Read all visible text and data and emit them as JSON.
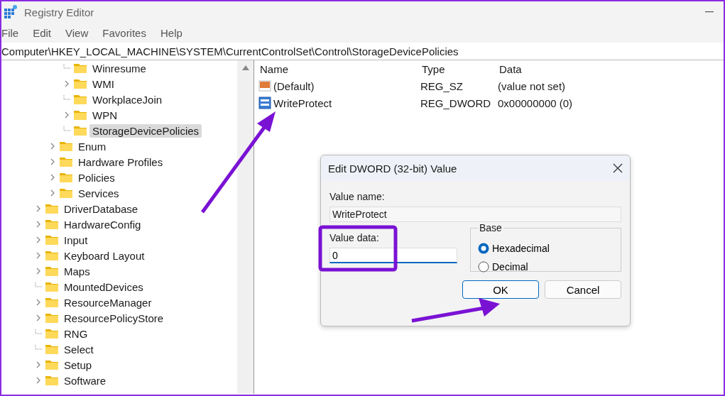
{
  "window": {
    "title": "Registry Editor"
  },
  "menu": [
    "File",
    "Edit",
    "View",
    "Favorites",
    "Help"
  ],
  "address": "Computer\\HKEY_LOCAL_MACHINE\\SYSTEM\\CurrentControlSet\\Control\\StorageDevicePolicies",
  "tree": [
    {
      "children": [
        {
          "children": [
            {
              "label": "Winresume",
              "expandable": false,
              "selected": false
            },
            {
              "label": "WMI",
              "expandable": true,
              "selected": false
            },
            {
              "label": "WorkplaceJoin",
              "expandable": false,
              "selected": false
            },
            {
              "label": "WPN",
              "expandable": true,
              "selected": false
            },
            {
              "label": "StorageDevicePolicies",
              "expandable": false,
              "selected": true
            }
          ]
        },
        {
          "label": "Enum",
          "expandable": true,
          "selected": false
        },
        {
          "label": "Hardware Profiles",
          "expandable": true,
          "selected": false
        },
        {
          "label": "Policies",
          "expandable": true,
          "selected": false
        },
        {
          "label": "Services",
          "expandable": true,
          "selected": false
        }
      ]
    },
    {
      "label": "DriverDatabase",
      "expandable": true,
      "selected": false
    },
    {
      "label": "HardwareConfig",
      "expandable": true,
      "selected": false
    },
    {
      "label": "Input",
      "expandable": true,
      "selected": false
    },
    {
      "label": "Keyboard Layout",
      "expandable": true,
      "selected": false
    },
    {
      "label": "Maps",
      "expandable": true,
      "selected": false
    },
    {
      "label": "MountedDevices",
      "expandable": false,
      "selected": false
    },
    {
      "label": "ResourceManager",
      "expandable": true,
      "selected": false
    },
    {
      "label": "ResourcePolicyStore",
      "expandable": true,
      "selected": false
    },
    {
      "label": "RNG",
      "expandable": false,
      "selected": false
    },
    {
      "label": "Select",
      "expandable": false,
      "selected": false
    },
    {
      "label": "Setup",
      "expandable": true,
      "selected": false
    },
    {
      "label": "Software",
      "expandable": true,
      "selected": false
    }
  ],
  "values": {
    "columns": [
      "Name",
      "Type",
      "Data"
    ],
    "rows": [
      {
        "kind": "string",
        "name": "(Default)",
        "type": "REG_SZ",
        "data": "(value not set)"
      },
      {
        "kind": "binary",
        "name": "WriteProtect",
        "type": "REG_DWORD",
        "data": "0x00000000 (0)"
      }
    ]
  },
  "dialog": {
    "title": "Edit DWORD (32-bit) Value",
    "value_name_label": "Value name:",
    "value_name": "WriteProtect",
    "value_data_label": "Value data:",
    "value_data": "0",
    "base_label": "Base",
    "bases": [
      {
        "label": "Hexadecimal",
        "selected": true
      },
      {
        "label": "Decimal",
        "selected": false
      }
    ],
    "buttons": [
      {
        "label": "OK",
        "default": true
      },
      {
        "label": "Cancel",
        "default": false
      }
    ]
  }
}
